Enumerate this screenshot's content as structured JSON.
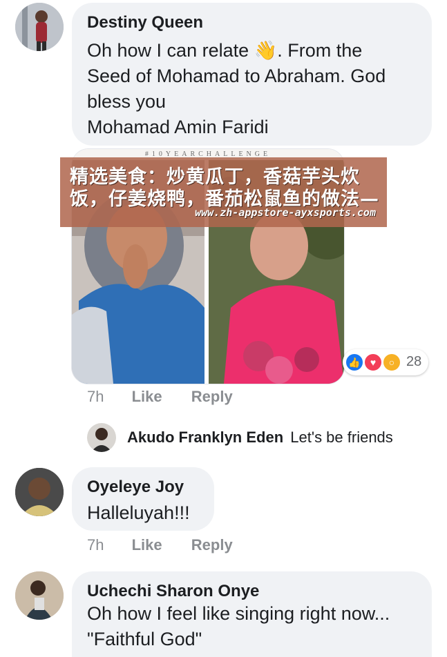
{
  "comments": [
    {
      "author": "Destiny Queen",
      "lines": [
        "Oh how I can relate 👋. From the",
        "Seed of Mohamad to Abraham. God",
        "bless you",
        "Mohamad Amin Faridi"
      ]
    },
    {
      "author": "Oyeleye Joy",
      "lines": [
        "Halleluyah!!!"
      ],
      "time": "7h",
      "like": "Like",
      "reply": "Reply"
    },
    {
      "author": "Uchechi Sharon Onye",
      "lines": [
        "Oh how I feel like singing right now...",
        "\"Faithful God\""
      ]
    }
  ],
  "photo": {
    "banner": "#10YEARCHALLENGE",
    "overlay_line1": "精选美食：炒黄瓜丁，香菇芋头炊",
    "overlay_line2": "饭，仔姜烧鸭，番茄松鼠鱼的做法—",
    "overlay_url": "www.zh-appstore-ayxsports.com",
    "reaction_icons": [
      "like-icon",
      "love-icon",
      "wow-icon"
    ],
    "reaction_colors": {
      "like": "#1877f2",
      "love": "#f33e58",
      "wow": "#f7b125"
    },
    "reaction_count": "28"
  },
  "comment1_meta": {
    "time": "7h",
    "like": "Like",
    "reply": "Reply"
  },
  "reply_preview": {
    "author": "Akudo Franklyn Eden",
    "text": "Let's be friends"
  }
}
